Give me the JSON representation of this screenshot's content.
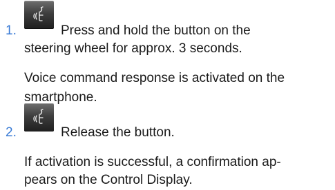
{
  "steps": [
    {
      "number": "1.",
      "icon": "voice-command-icon",
      "instruction_line1": "Press and hold the button on the",
      "instruction_line2": "steering wheel for approx. 3 seconds.",
      "result_line1": "Voice command response is activated on the",
      "result_line2": "smartphone."
    },
    {
      "number": "2.",
      "icon": "voice-command-icon",
      "instruction_line1": "Release the button.",
      "result_line1": "If activation is successful, a confirmation ap-",
      "result_line2": "pears on the Control Display."
    }
  ],
  "colors": {
    "step_number": "#3a7bd5",
    "text": "#1a1a1a",
    "icon_background": "#2f2f2f"
  }
}
